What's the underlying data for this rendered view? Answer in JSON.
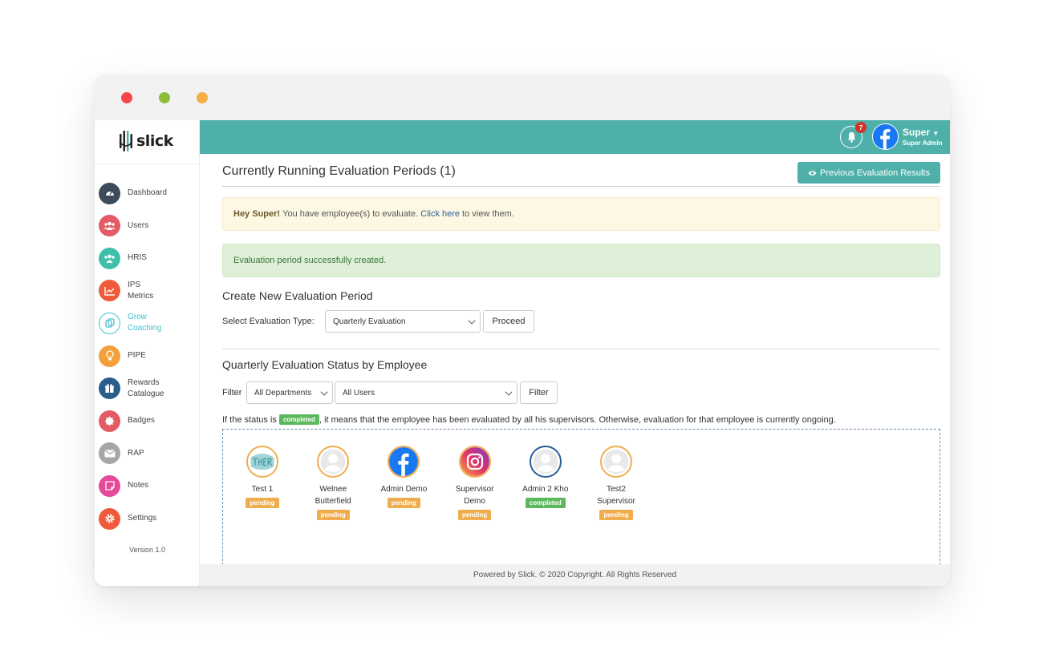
{
  "brand": {
    "name": "slick"
  },
  "colors": {
    "accent": "#4fb0aa",
    "completed": "#5cb85c",
    "pending": "#f0ad4e"
  },
  "sidebar": {
    "items": [
      {
        "label": "Dashboard",
        "icon": "dashboard-icon",
        "color": "#3c4a5a"
      },
      {
        "label": "Users",
        "icon": "users-icon",
        "color": "#e25b66"
      },
      {
        "label": "HRIS",
        "icon": "hris-icon",
        "color": "#3dbfa8"
      },
      {
        "label": "IPS\nMetrics",
        "icon": "chart-line-icon",
        "color": "#ef5a3a"
      },
      {
        "label": "Grow\nCoaching",
        "icon": "coaching-icon",
        "color": "#ffffff",
        "active": true
      },
      {
        "label": "PIPE",
        "icon": "lightbulb-icon",
        "color": "#f3a03a"
      },
      {
        "label": "Rewards\nCatalogue",
        "icon": "gift-icon",
        "color": "#2a5d8c"
      },
      {
        "label": "Badges",
        "icon": "badge-icon",
        "color": "#e25b66"
      },
      {
        "label": "RAP",
        "icon": "mail-icon",
        "color": "#a6a6a6"
      },
      {
        "label": "Notes",
        "icon": "notes-icon",
        "color": "#e6489a"
      },
      {
        "label": "Settings",
        "icon": "gear-icon",
        "color": "#ef5a3a"
      }
    ],
    "version": "Version 1.0"
  },
  "topbar": {
    "notification_count": "7",
    "user_name": "Super",
    "user_role": "Super Admin"
  },
  "main": {
    "title": "Currently Running Evaluation Periods (1)",
    "prev_results_label": "Previous Evaluation Results",
    "alert_warning": {
      "greeting": "Hey Super!",
      "text_before": "You have employee(s) to evaluate.",
      "link": "Click here",
      "text_after": "to view them."
    },
    "alert_success": "Evaluation period successfully created.",
    "create_section_title": "Create New Evaluation Period",
    "select_type_label": "Select Evaluation Type:",
    "eval_type_value": "Quarterly Evaluation",
    "proceed_label": "Proceed",
    "status_section_title": "Quarterly Evaluation Status by Employee",
    "filter_label": "Filter",
    "department_value": "All Departments",
    "users_value": "All Users",
    "filter_button_label": "Filter",
    "status_note_before": "If the status is",
    "status_note_tag": "completed",
    "status_note_after": ", it means that the employee has been evaluated by all his supervisors. Otherwise, evaluation for that employee is currently ongoing."
  },
  "employees": [
    {
      "name": "Test 1",
      "status": "pending",
      "avatar": "thermo-logo"
    },
    {
      "name": "Welnee\nButterfield",
      "status": "pending",
      "avatar": "default-avatar"
    },
    {
      "name": "Admin Demo",
      "status": "pending",
      "avatar": "facebook-logo"
    },
    {
      "name": "Supervisor\nDemo",
      "status": "pending",
      "avatar": "instagram-logo"
    },
    {
      "name": "Admin 2 Kho",
      "status": "completed",
      "avatar": "default-avatar"
    },
    {
      "name": "Test2\nSupervisor",
      "status": "pending",
      "avatar": "default-avatar"
    }
  ],
  "footer": "Powered by Slick. © 2020 Copyright. All Rights Reserved"
}
